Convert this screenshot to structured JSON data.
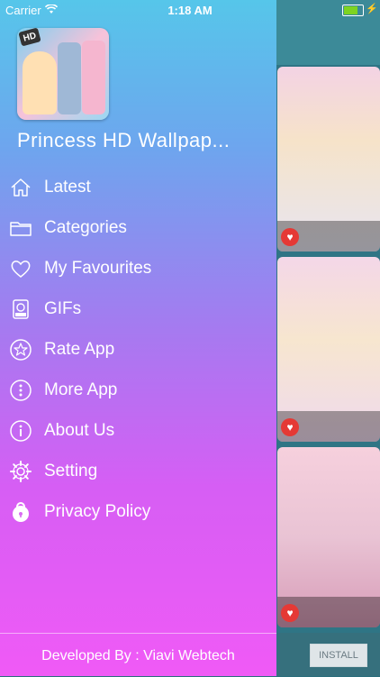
{
  "status": {
    "carrier": "Carrier",
    "time": "1:18 AM"
  },
  "drawer": {
    "app_title": "Princess HD Wallpap...",
    "logo_badge": "HD",
    "items": [
      {
        "label": "Latest",
        "icon": "home-icon"
      },
      {
        "label": "Categories",
        "icon": "folder-icon"
      },
      {
        "label": "My Favourites",
        "icon": "heart-icon"
      },
      {
        "label": "GIFs",
        "icon": "gif-icon"
      },
      {
        "label": "Rate App",
        "icon": "star-icon"
      },
      {
        "label": "More App",
        "icon": "more-icon"
      },
      {
        "label": "About Us",
        "icon": "info-icon"
      },
      {
        "label": "Setting",
        "icon": "gear-icon"
      },
      {
        "label": "Privacy Policy",
        "icon": "lock-icon"
      }
    ],
    "footer": "Developed By : Viavi Webtech"
  },
  "background": {
    "install_label": "INSTALL"
  }
}
